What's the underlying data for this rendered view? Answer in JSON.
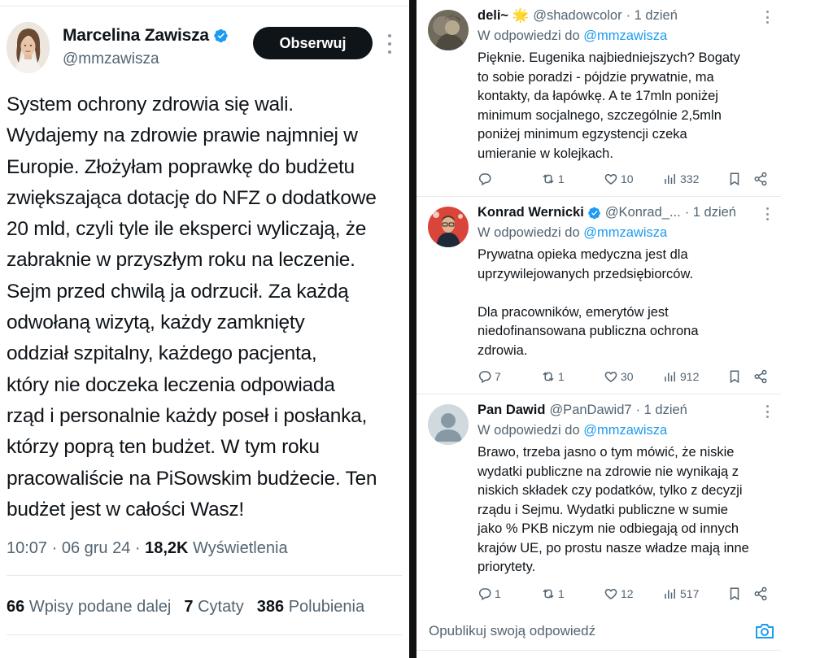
{
  "main_tweet": {
    "author_name": "Marcelina Zawisza",
    "author_handle": "@mmzawisza",
    "follow_label": "Obserwuj",
    "text": "System ochrony zdrowia się wali.\nWydajemy na zdrowie prawie najmniej w\nEuropie. Złożyłam poprawkę do budżetu\nzwiększająca dotację do NFZ o dodatkowe\n20 mld, czyli tyle ile eksperci wyliczają, że\nzabraknie w przyszłym roku na leczenie.\nSejm przed chwilą ja odrzucił. Za każdą\nodwołaną wizytą, każdy zamknięty\noddział szpitalny, każdego pacjenta,\nktóry nie doczeka leczenia odpowiada\nrząd i personalnie każdy poseł i posłanka,\nktórzy poprą ten budżet. W tym roku\npracowaliście na PiSowskim budżecie. Ten\nbudżet jest w całości Wasz!",
    "time": "10:07 · 06 gru 24 · ",
    "views_count": "18,2K",
    "views_label": " Wyświetlenia",
    "reposts_count": "66",
    "reposts_label": "Wpisy podane dalej",
    "quotes_count": "7",
    "quotes_label": "Cytaty",
    "likes_count": "386",
    "likes_label": "Polubienia"
  },
  "replies": [
    {
      "name": "deli~ 🌟",
      "handle": "@shadowcolor",
      "time": "· 1 dzień",
      "reply_to_prefix": "W odpowiedzi do ",
      "reply_to_mention": "@mmzawisza",
      "text": "Pięknie. Eugenika najbiedniejszych? Bogaty\nto sobie poradzi - pójdzie prywatnie, ma\nkontakty, da łapówkę. A te 17mln poniżej\nminimum socjalnego, szczególnie 2,5mln\nponiżej minimum egzystencji czeka\numieranie w kolejkach.",
      "replies": "",
      "reposts": "1",
      "likes": "10",
      "views": "332",
      "verified": false
    },
    {
      "name": "Konrad Wernicki",
      "handle": "@Konrad_...",
      "time": "· 1 dzień",
      "reply_to_prefix": "W odpowiedzi do ",
      "reply_to_mention": "@mmzawisza",
      "text": "Prywatna opieka medyczna jest dla\nuprzywilejowanych przedsiębiorców.\n\nDla pracowników, emerytów jest\nniedofinansowana publiczna ochrona\nzdrowia.",
      "replies": "7",
      "reposts": "1",
      "likes": "30",
      "views": "912",
      "verified": true
    },
    {
      "name": "Pan Dawid",
      "handle": "@PanDawid7",
      "time": "· 1 dzień",
      "reply_to_prefix": "W odpowiedzi do ",
      "reply_to_mention": "@mmzawisza",
      "text": "Brawo, trzeba jasno o tym mówić, że niskie\nwydatki publiczne na zdrowie nie wynikają z\nniskich składek czy podatków, tylko z decyzji\nrządu i Sejmu. Wydatki publiczne w sumie\njako % PKB niczym nie odbiegają od innych\nkrajów UE, po prostu nasze władze mają inne\npriorytety.",
      "replies": "1",
      "reposts": "1",
      "likes": "12",
      "views": "517",
      "verified": false
    }
  ],
  "compose": {
    "placeholder": "Opublikuj swoją odpowiedź"
  },
  "colors": {
    "text": "#0f1419",
    "secondary": "#536471",
    "accent": "#1d9bf0",
    "button_bg": "#0f1419",
    "divider": "#111111"
  }
}
